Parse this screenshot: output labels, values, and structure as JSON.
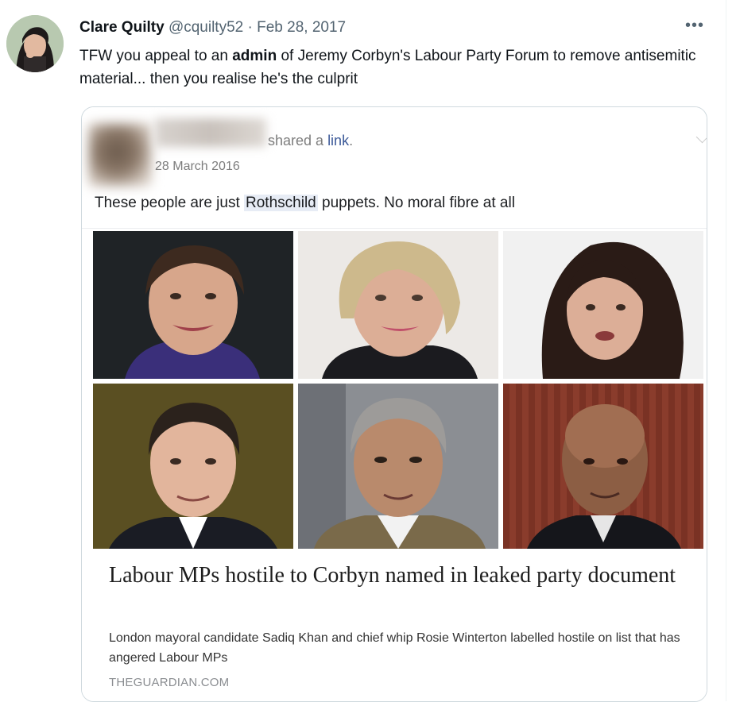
{
  "tweet": {
    "author_name": "Clare Quilty",
    "handle": "@cquilty52",
    "separator": "·",
    "date": "Feb 28, 2017",
    "more_icon": "more-horizontal-icon",
    "text_before": "TFW you appeal to an ",
    "text_bold": "admin",
    "text_after": " of Jeremy Corbyn's Labour Party Forum to remove antisemitic material... then you realise he's the culprit"
  },
  "embedded_post": {
    "shared_text": "shared a ",
    "shared_link": "link",
    "shared_period": ".",
    "date": "28 March 2016",
    "text_before": "These people are just ",
    "text_highlight": "Rothschild",
    "text_after": " puppets. No moral fibre at all",
    "article": {
      "headline": "Labour MPs hostile to Corbyn named in leaked party document",
      "description": "London mayoral candidate Sadiq Khan and chief whip Rosie Winterton labelled hostile on list that has angered Labour MPs",
      "domain": "THEGUARDIAN.COM"
    }
  },
  "colors": {
    "text_primary": "#0f1419",
    "text_secondary": "#536471",
    "card_border": "#cfd9de",
    "facebook_link": "#3b5998"
  }
}
